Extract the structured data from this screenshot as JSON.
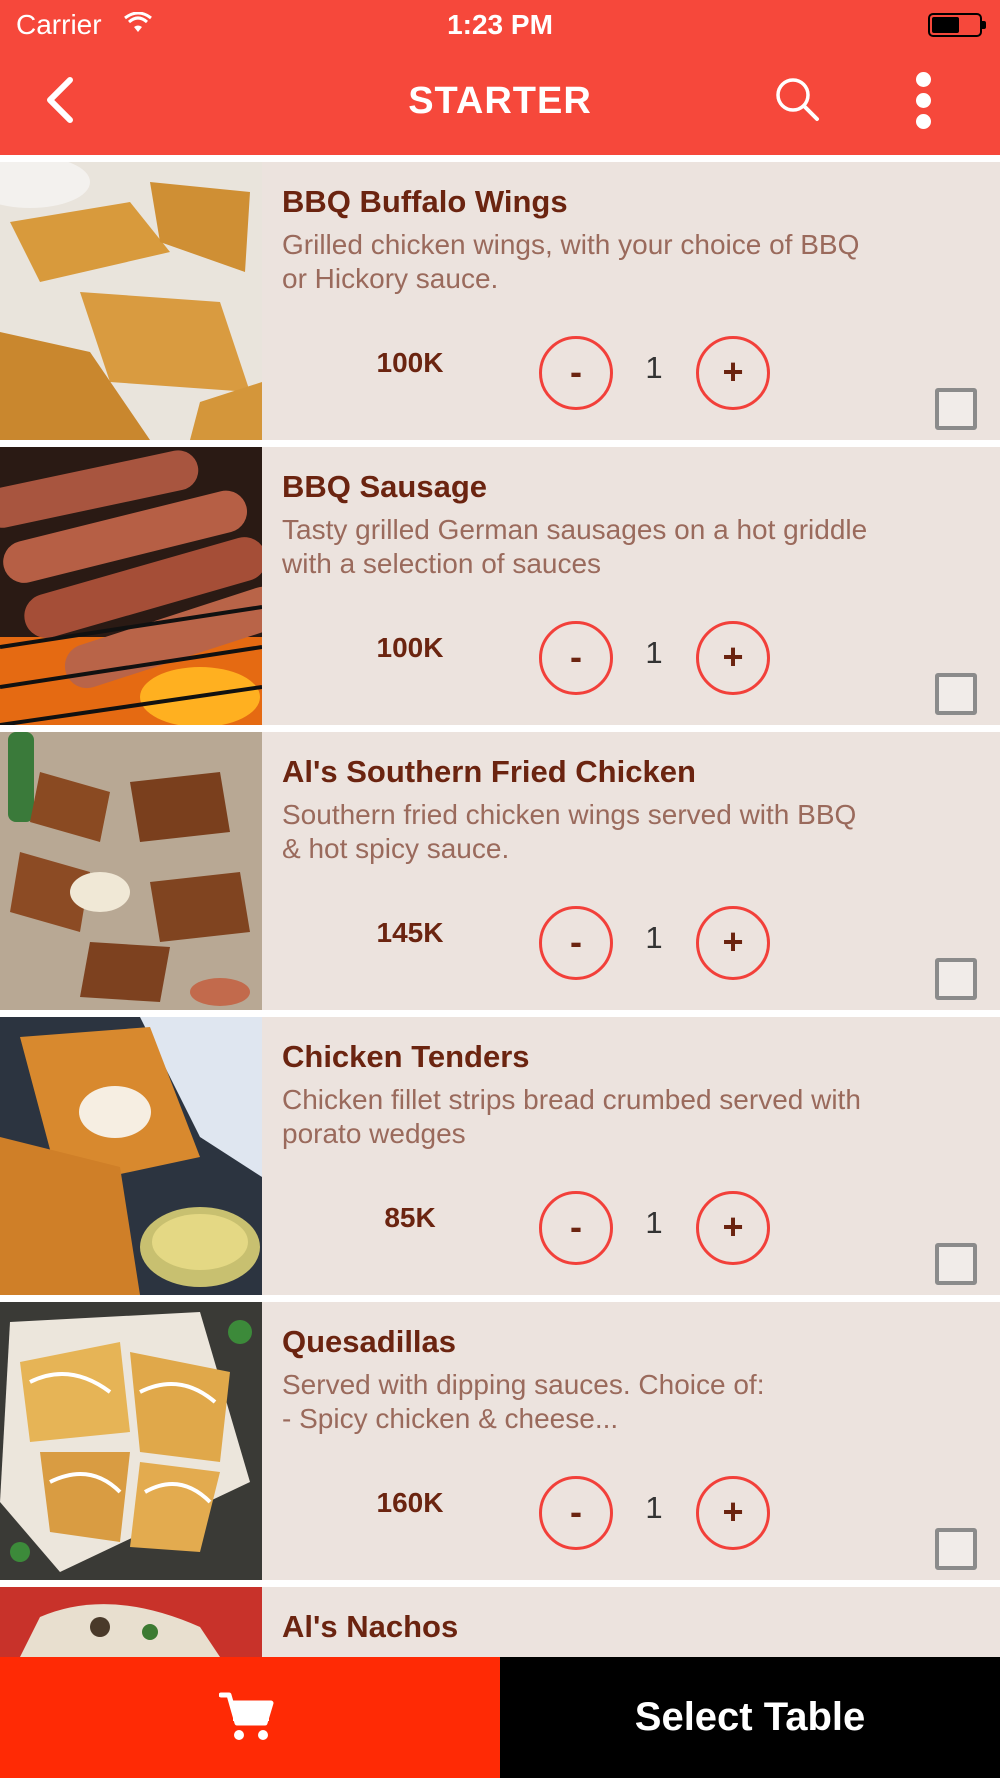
{
  "status_bar": {
    "carrier": "Carrier",
    "time": "1:23 PM"
  },
  "header": {
    "title": "STARTER"
  },
  "items": [
    {
      "name": "BBQ Buffalo Wings",
      "description": "Grilled chicken wings, with your choice of BBQ\nor Hickory sauce.",
      "price": "100K",
      "quantity": "1",
      "minus": "-",
      "plus": "+"
    },
    {
      "name": "BBQ Sausage",
      "description": "Tasty grilled German sausages on a hot griddle\nwith a selection of sauces",
      "price": "100K",
      "quantity": "1",
      "minus": "-",
      "plus": "+"
    },
    {
      "name": "Al's Southern Fried Chicken",
      "description": "Southern fried chicken wings served with BBQ\n& hot spicy sauce.",
      "price": "145K",
      "quantity": "1",
      "minus": "-",
      "plus": "+"
    },
    {
      "name": "Chicken Tenders",
      "description": "Chicken fillet strips bread crumbed served with\nporato wedges",
      "price": "85K",
      "quantity": "1",
      "minus": "-",
      "plus": "+"
    },
    {
      "name": "Quesadillas",
      "description": "Served with dipping sauces. Choice of:\n- Spicy chicken & cheese...",
      "price": "160K",
      "quantity": "1",
      "minus": "-",
      "plus": "+"
    },
    {
      "name": "Al's Nachos"
    }
  ],
  "bottom_bar": {
    "cart_icon": "cart-icon",
    "select_table": "Select Table"
  },
  "colors": {
    "header": "#f6483b",
    "cart_button": "#ff2a05",
    "item_background": "#ece3de",
    "item_title": "#6b2410",
    "accent_circle": "#f2403a"
  }
}
